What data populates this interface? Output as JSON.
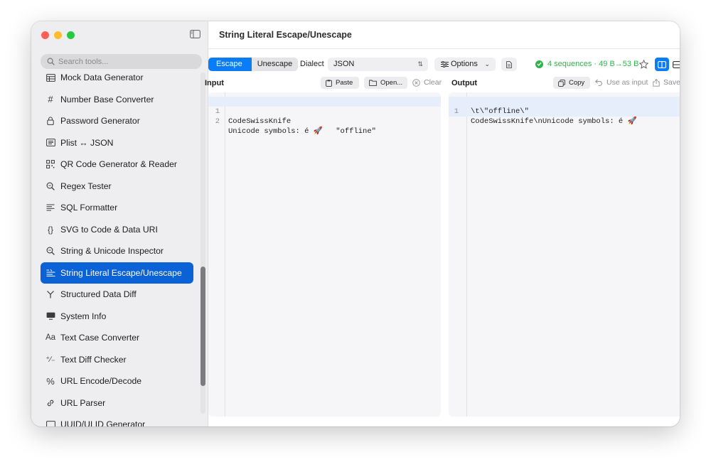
{
  "window": {
    "title": "String Literal Escape/Unescape"
  },
  "sidebar": {
    "search_placeholder": "Search tools...",
    "items": [
      {
        "label": "Mock Data Generator",
        "icon": "table-icon"
      },
      {
        "label": "Number Base Converter",
        "icon": "hash-icon"
      },
      {
        "label": "Password Generator",
        "icon": "lock-icon"
      },
      {
        "label": "Plist ↔ JSON",
        "icon": "list-doc-icon"
      },
      {
        "label": "QR Code Generator & Reader",
        "icon": "qrcode-icon"
      },
      {
        "label": "Regex Tester",
        "icon": "magnifier-icon"
      },
      {
        "label": "SQL Formatter",
        "icon": "text-align-icon"
      },
      {
        "label": "SVG to Code & Data URI",
        "icon": "braces-icon"
      },
      {
        "label": "String & Unicode Inspector",
        "icon": "magnifier-icon"
      },
      {
        "label": "String Literal Escape/Unescape",
        "icon": "escape-icon",
        "selected": true
      },
      {
        "label": "Structured Data Diff",
        "icon": "branch-icon"
      },
      {
        "label": "System Info",
        "icon": "monitor-icon"
      },
      {
        "label": "Text Case Converter",
        "icon": "text-case-icon"
      },
      {
        "label": "Text Diff Checker",
        "icon": "plus-minus-icon"
      },
      {
        "label": "URL Encode/Decode",
        "icon": "percent-icon"
      },
      {
        "label": "URL Parser",
        "icon": "link-icon"
      },
      {
        "label": "UUID/ULID Generator",
        "icon": "id-icon"
      }
    ]
  },
  "toolbar": {
    "mode_escape": "Escape",
    "mode_unescape": "Unescape",
    "active_mode": "Escape",
    "dialect_label": "Dialect",
    "dialect_value": "JSON",
    "options_label": "Options",
    "status": "4 sequences · 49 B→53 B",
    "status_color": "#30b34a",
    "accent_color": "#0a7cf5"
  },
  "input_pane": {
    "title": "Input",
    "paste_label": "Paste",
    "open_label": "Open...",
    "clear_label": "Clear",
    "lines": [
      {
        "num": "1",
        "text": "CodeSwissKnife"
      },
      {
        "num": "2",
        "text": "Unicode symbols: é 🚀\t\"offline\""
      }
    ]
  },
  "output_pane": {
    "title": "Output",
    "copy_label": "Copy",
    "use_as_input_label": "Use as input",
    "save_label": "Save...",
    "lines": [
      {
        "num": "1",
        "text": "CodeSwissKnife\\nUnicode symbols: é 🚀"
      },
      {
        "num": "",
        "text": "\\t\\\"offline\\\""
      }
    ]
  }
}
